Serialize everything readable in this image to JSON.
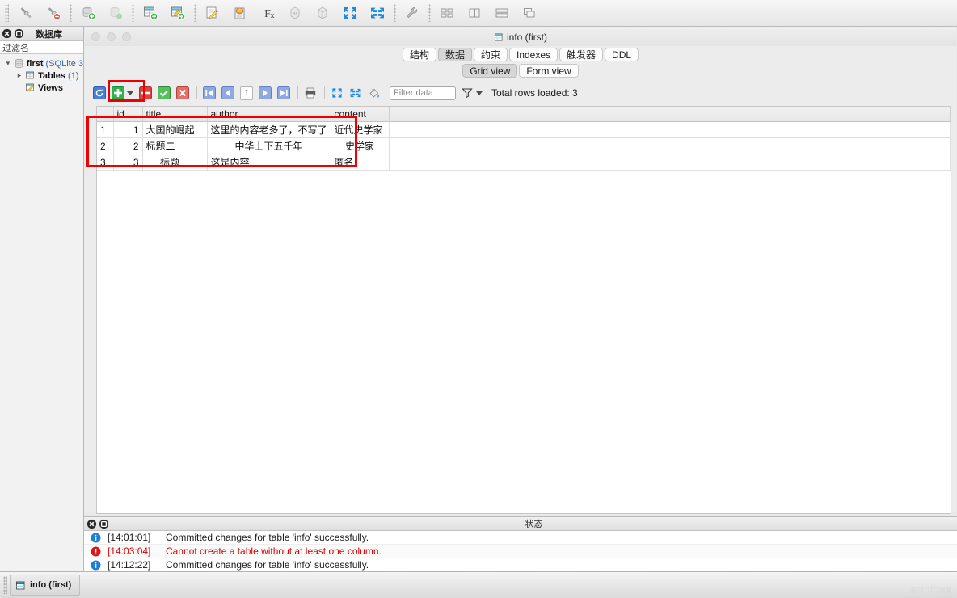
{
  "app": {
    "toolbar_buttons": [
      {
        "name": "connect-icon",
        "label": "Connect"
      },
      {
        "name": "disconnect-icon",
        "label": "Disconnect"
      },
      {
        "name": "new-database-icon",
        "label": "New Database"
      },
      {
        "name": "open-database-icon",
        "label": "Open Database"
      },
      {
        "name": "new-table-icon",
        "label": "New Table"
      },
      {
        "name": "edit-table-icon",
        "label": "Edit Table"
      },
      {
        "name": "new-view-icon",
        "label": "New View"
      },
      {
        "name": "new-index-icon",
        "label": "New Index"
      },
      {
        "name": "new-trigger-icon",
        "label": "Fx"
      },
      {
        "name": "sort-icon",
        "label": "Sort"
      },
      {
        "name": "package-icon",
        "label": "Package"
      },
      {
        "name": "collapse-all-icon",
        "label": "Collapse All"
      },
      {
        "name": "expand-all-icon",
        "label": "Expand All"
      },
      {
        "name": "tools-icon",
        "label": "Tools"
      },
      {
        "name": "tile-icon",
        "label": "Tile Windows"
      },
      {
        "name": "tile-vertical-icon",
        "label": "Tile Vertically"
      },
      {
        "name": "tile-horizontal-icon",
        "label": "Tile Horizontally"
      },
      {
        "name": "cascade-icon",
        "label": "Cascade"
      }
    ]
  },
  "sidebar": {
    "title": "数据库",
    "filter_placeholder": "过滤名",
    "filter_value": "",
    "tree": [
      {
        "label": "first",
        "detail": "(SQLite 3",
        "icon": "database-icon",
        "indent": 0,
        "expanded": true
      },
      {
        "label": "Tables",
        "detail": "(1)",
        "icon": "tables-icon",
        "indent": 1,
        "expanded": false
      },
      {
        "label": "Views",
        "detail": "",
        "icon": "views-icon",
        "indent": 1,
        "expanded": null
      }
    ]
  },
  "window": {
    "title": "info (first)",
    "title_icon": "table-icon",
    "tabs": [
      {
        "label": "结构",
        "selected": false
      },
      {
        "label": "数据",
        "selected": true
      },
      {
        "label": "约束",
        "selected": false
      },
      {
        "label": "Indexes",
        "selected": false
      },
      {
        "label": "触发器",
        "selected": false
      },
      {
        "label": "DDL",
        "selected": false
      }
    ],
    "view_tabs": [
      {
        "label": "Grid view",
        "selected": true
      },
      {
        "label": "Form view",
        "selected": false
      }
    ]
  },
  "grid_toolbar": {
    "buttons": [
      {
        "name": "refresh-button",
        "label": "Refresh"
      },
      {
        "name": "add-record-button",
        "label": "Add Record"
      },
      {
        "name": "add-record-dropdown",
        "label": "Add Record Options"
      },
      {
        "name": "delete-record-button",
        "label": "Delete Record"
      },
      {
        "name": "apply-changes-button",
        "label": "Apply Changes"
      },
      {
        "name": "cancel-changes-button",
        "label": "Cancel Changes"
      },
      {
        "name": "first-page-button",
        "label": "First Page"
      },
      {
        "name": "previous-page-button",
        "label": "Previous Page"
      },
      {
        "name": "next-page-button",
        "label": "Next Page"
      },
      {
        "name": "last-page-button",
        "label": "Last Page"
      },
      {
        "name": "print-button",
        "label": "Print"
      },
      {
        "name": "collapse-rows-button",
        "label": "Collapse"
      },
      {
        "name": "expand-rows-button",
        "label": "Expand"
      },
      {
        "name": "fill-button",
        "label": "Fill"
      }
    ],
    "page_number": "1",
    "filter_placeholder": "Filter data",
    "filter_value": "",
    "rows_loaded": "Total rows loaded: 3"
  },
  "grid": {
    "columns": [
      "id",
      "title",
      "author",
      "content"
    ],
    "rows": [
      {
        "n": "1",
        "id": "1",
        "title": "大国的崛起",
        "author": "这里的内容老多了，不写了",
        "content": "近代史学家"
      },
      {
        "n": "2",
        "id": "2",
        "title": "标题二",
        "author": "中华上下五千年",
        "content": "史学家"
      },
      {
        "n": "3",
        "id": "3",
        "title": "标题一",
        "author": "这是内容",
        "content": "匿名"
      }
    ]
  },
  "log": {
    "title": "状态",
    "entries": [
      {
        "level": "info",
        "time": "[14:01:01]",
        "message": "Committed changes for table 'info' successfully."
      },
      {
        "level": "error",
        "time": "[14:03:04]",
        "message": "Cannot create a table without at least one column."
      },
      {
        "level": "info",
        "time": "[14:12:22]",
        "message": "Committed changes for table 'info' successfully."
      }
    ]
  },
  "taskbar": {
    "items": [
      {
        "label": "info (first)",
        "icon": "table-icon"
      }
    ]
  },
  "watermark": "@51CTO博客",
  "colors": {
    "accent_blue": "#3465a4",
    "highlight_red": "#ee0000",
    "error_red": "#dd0000",
    "add_green": "#2db34a",
    "delete_red": "#d9443f"
  }
}
